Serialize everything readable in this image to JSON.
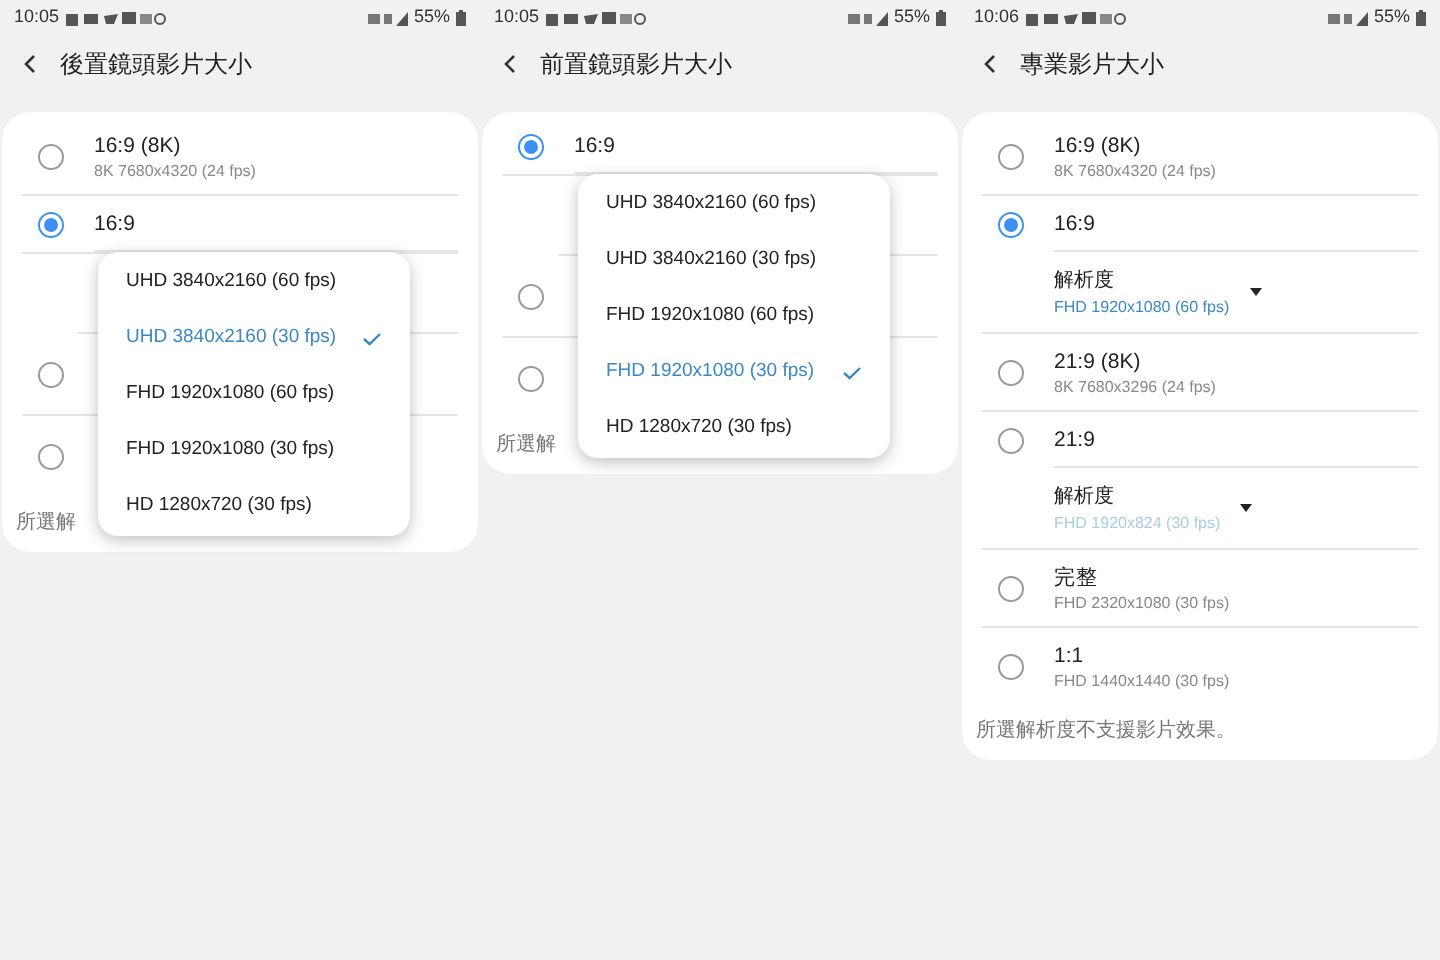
{
  "screens": [
    {
      "status_bar": {
        "time": "10:05",
        "battery": "55%"
      },
      "title": "後置鏡頭影片大小",
      "options": [
        {
          "kind": "option",
          "label": "16:9 (8K)",
          "subtitle": "8K 7680x4320 (24 fps)",
          "selected": false
        },
        {
          "kind": "option",
          "label": "16:9",
          "selected": true,
          "menu": [
            {
              "label": "UHD 3840x2160 (60 fps)",
              "selected": false
            },
            {
              "label": "UHD 3840x2160 (30 fps)",
              "selected": true
            },
            {
              "label": "FHD 1920x1080 (60 fps)",
              "selected": false
            },
            {
              "label": "FHD 1920x1080 (30 fps)",
              "selected": false
            },
            {
              "label": "HD 1280x720 (30 fps)",
              "selected": false
            }
          ]
        },
        {
          "kind": "covered"
        },
        {
          "kind": "option",
          "selected": false
        },
        {
          "kind": "option",
          "selected": false
        }
      ],
      "footer": "所選解"
    },
    {
      "status_bar": {
        "time": "10:05",
        "battery": "55%"
      },
      "title": "前置鏡頭影片大小",
      "options": [
        {
          "kind": "option",
          "label": "16:9",
          "selected": true,
          "menu": [
            {
              "label": "UHD 3840x2160 (60 fps)",
              "selected": false
            },
            {
              "label": "UHD 3840x2160 (30 fps)",
              "selected": false
            },
            {
              "label": "FHD 1920x1080 (60 fps)",
              "selected": false
            },
            {
              "label": "FHD 1920x1080 (30 fps)",
              "selected": true
            },
            {
              "label": "HD 1280x720 (30 fps)",
              "selected": false
            }
          ]
        },
        {
          "kind": "covered"
        },
        {
          "kind": "option",
          "selected": false
        },
        {
          "kind": "option",
          "selected": false
        }
      ],
      "footer": "所選解"
    },
    {
      "status_bar": {
        "time": "10:06",
        "battery": "55%"
      },
      "title": "專業影片大小",
      "options": [
        {
          "kind": "option",
          "label": "16:9 (8K)",
          "subtitle": "8K 7680x4320 (24 fps)",
          "selected": false
        },
        {
          "kind": "option",
          "label": "16:9",
          "selected": true,
          "resolution": {
            "label": "解析度",
            "value": "FHD 1920x1080 (60 fps)",
            "disabled": false
          }
        },
        {
          "kind": "option",
          "label": "21:9 (8K)",
          "subtitle": "8K 7680x3296 (24 fps)",
          "selected": false
        },
        {
          "kind": "option",
          "label": "21:9",
          "selected": false,
          "resolution": {
            "label": "解析度",
            "value": "FHD 1920x824 (30 fps)",
            "disabled": true
          }
        },
        {
          "kind": "option",
          "label": "完整",
          "subtitle": "FHD 2320x1080 (30 fps)",
          "selected": false
        },
        {
          "kind": "option",
          "label": "1:1",
          "subtitle": "FHD 1440x1440 (30 fps)",
          "selected": false
        }
      ],
      "footer": "所選解析度不支援影片效果。"
    }
  ]
}
